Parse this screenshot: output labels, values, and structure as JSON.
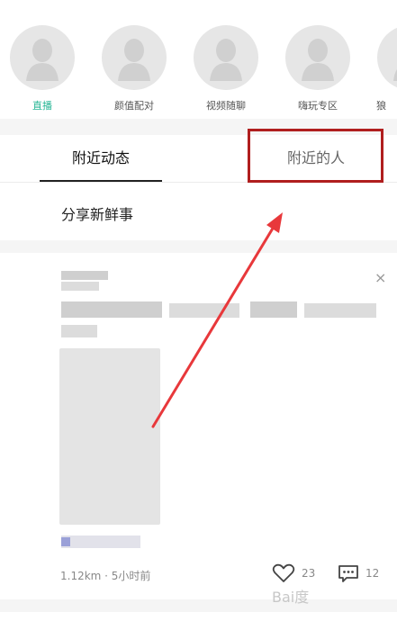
{
  "quick_items": [
    {
      "label": "直播",
      "active": true
    },
    {
      "label": "颜值配对",
      "active": false
    },
    {
      "label": "视频随聊",
      "active": false
    },
    {
      "label": "嗨玩专区",
      "active": false
    },
    {
      "label": "狼",
      "active": false
    }
  ],
  "tabs": {
    "nearby_feed": "附近动态",
    "nearby_people": "附近的人"
  },
  "share_label": "分享新鲜事",
  "post": {
    "close_glyph": "×",
    "distance_time": "1.12km · 5小时前",
    "likes": "23",
    "comments": "12"
  },
  "watermark": "Bai度",
  "colors": {
    "accent": "#25b594",
    "highlight": "#b01e1e",
    "arrow": "#e8383b"
  }
}
